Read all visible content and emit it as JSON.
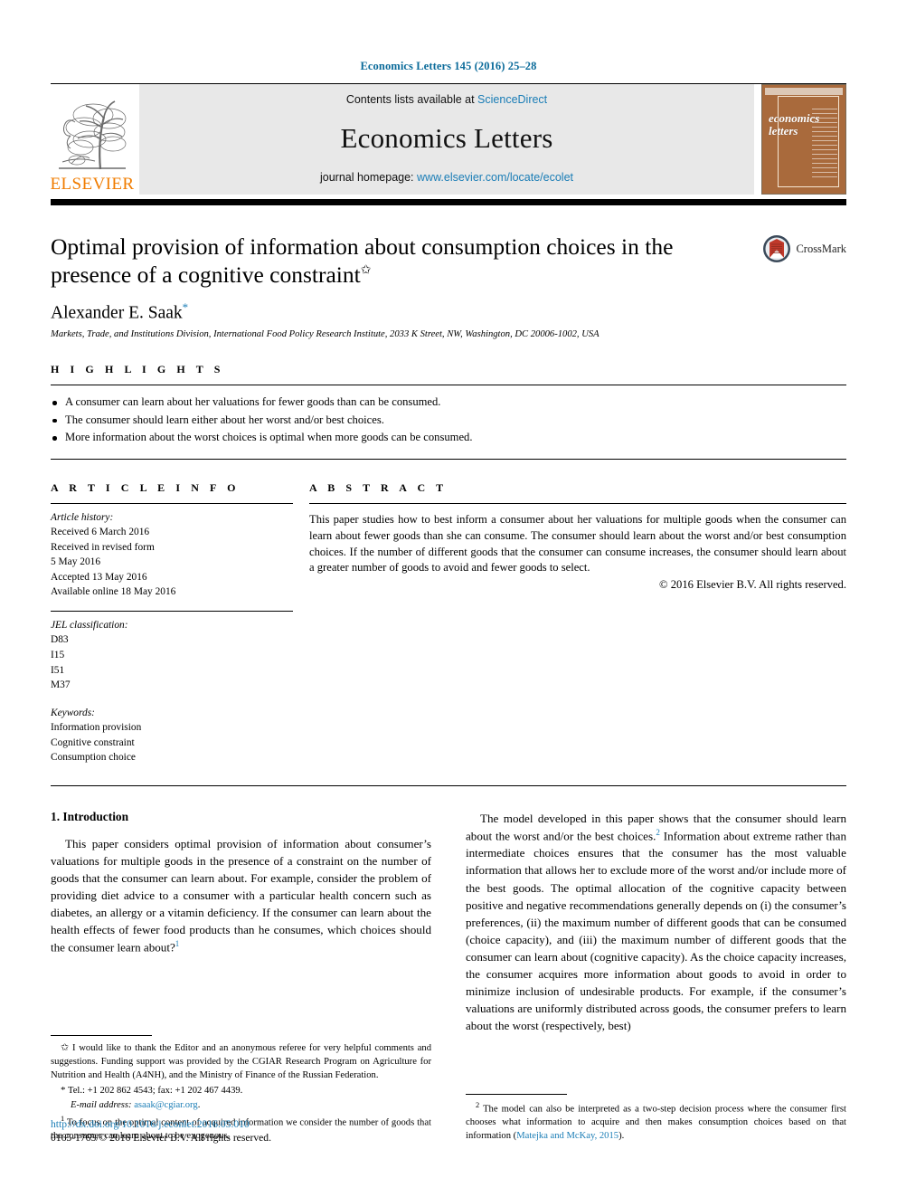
{
  "running_head": "Economics Letters 145 (2016) 25–28",
  "masthead": {
    "contents_prefix": "Contents lists available at ",
    "contents_link": "ScienceDirect",
    "journal_name": "Economics Letters",
    "homepage_prefix": "journal homepage: ",
    "homepage_link": "www.elsevier.com/locate/ecolet",
    "publisher_wordmark": "ELSEVIER",
    "cover_title_line1": "economics",
    "cover_title_line2": "letters"
  },
  "title_block": {
    "title": "Optimal provision of information about consumption choices in the presence of a cognitive constraint",
    "title_footnote_marker": "✩",
    "author": "Alexander E. Saak",
    "author_footnote_marker": "*",
    "affiliation": "Markets, Trade, and Institutions Division, International Food Policy Research Institute, 2033 K Street, NW, Washington, DC 20006-1002, USA",
    "crossmark_label": "CrossMark"
  },
  "highlights": {
    "label": "H I G H L I G H T S",
    "items": [
      "A consumer can learn about her valuations for fewer goods than can be consumed.",
      "The consumer should learn either about her worst and/or best choices.",
      "More information about the worst choices is optimal when more goods can be consumed."
    ]
  },
  "article_info": {
    "label": "A R T I C L E    I N F O",
    "history_head": "Article history:",
    "history_lines": [
      "Received 6 March 2016",
      "Received in revised form",
      "5 May 2016",
      "Accepted 13 May 2016",
      "Available online 18 May 2016"
    ],
    "jel_head": "JEL classification:",
    "jel_codes": [
      "D83",
      "I15",
      "I51",
      "M37"
    ],
    "keywords_head": "Keywords:",
    "keywords": [
      "Information provision",
      "Cognitive constraint",
      "Consumption choice"
    ]
  },
  "abstract": {
    "label": "A B S T R A C T",
    "text": "This paper studies how to best inform a consumer about her valuations for multiple goods when the consumer can learn about fewer goods than she can consume. The consumer should learn about the worst and/or best consumption choices. If the number of different goods that the consumer can consume increases, the consumer should learn about a greater number of goods to avoid and fewer goods to select.",
    "copyright": "© 2016 Elsevier B.V. All rights reserved."
  },
  "body": {
    "section_number_title": "1. Introduction",
    "left_paragraph_part1": "This paper considers optimal provision of information about consumer’s valuations for multiple goods in the presence of a constraint on the number of goods that the consumer can learn about. For example, consider the problem of providing diet advice to a consumer with a particular health concern such as diabetes, an allergy or a vitamin deficiency. If the consumer can learn about the health effects of fewer food products than he consumes, which choices should the consumer learn about?",
    "left_paragraph_marker": "1",
    "right_paragraph_part1": "The model developed in this paper shows that the consumer should learn about the worst and/or the best choices.",
    "right_paragraph_marker": "2",
    "right_paragraph_part2": "Information about extreme rather than intermediate choices ensures that the consumer has the most valuable information that allows her to exclude more of the worst and/or include more of the best goods. The optimal allocation of the cognitive capacity between positive and negative recommendations generally depends on (i) the consumer’s preferences, (ii) the maximum number of different goods that can be consumed (choice capacity), and (iii) the maximum number of different goods that the consumer can learn about (cognitive capacity). As the choice capacity increases, the consumer acquires more information about goods to avoid in order to minimize inclusion of undesirable products. For example, if the consumer’s valuations are uniformly distributed across goods, the consumer prefers to learn about the worst (respectively, best)"
  },
  "footnotes": {
    "left": {
      "star_marker": "✩",
      "star_text": "I would like to thank the Editor and an anonymous referee for very helpful comments and suggestions. Funding support was provided by the CGIAR Research Program on Agriculture for Nutrition and Health (A4NH), and the Ministry of Finance of the Russian Federation.",
      "corr_marker": "*",
      "corr_text": "Tel.: +1 202 862 4543; fax: +1 202 467 4439.",
      "email_label": "E-mail address:",
      "email": "asaak@cgiar.org",
      "note1_marker": "1",
      "note1_text": "To focus on the optimal content of acquired information we consider the number of goods that the consumer can learn about to be exogenous."
    },
    "right": {
      "note2_marker": "2",
      "note2_text_part1": "The model can also be interpreted as a two-step decision process where the consumer first chooses what information to acquire and then makes consumption choices based on that information (",
      "note2_citation": "Matejka and McKay, 2015",
      "note2_text_part2": ")."
    }
  },
  "footer": {
    "doi": "http://dx.doi.org/10.1016/j.econlet.2016.05.010",
    "issn_copyright": "0165-1765/© 2016 Elsevier B.V. All rights reserved."
  },
  "colors": {
    "link": "#1a7db6",
    "running_head": "#0b6b9a",
    "elsevier_orange": "#f07c00",
    "masthead_bg": "#e8e8e8",
    "cover_bg": "#a96a3c"
  }
}
